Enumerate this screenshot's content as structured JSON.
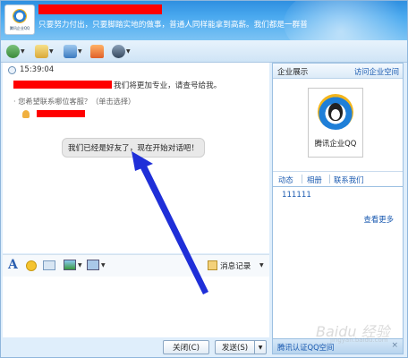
{
  "header": {
    "avatar_caption": "腾讯企业QQ",
    "signature": "只要努力付出，只要脚踏实地的做事，普通人同样能拿到高薪。我们都是一群普通人，我们同样..."
  },
  "toolbar": {
    "buttons": [
      {
        "icon": "add-contact-icon"
      },
      {
        "icon": "file-transfer-icon"
      },
      {
        "icon": "video-icon"
      },
      {
        "icon": "home-icon"
      },
      {
        "icon": "agent-icon"
      }
    ]
  },
  "chat": {
    "timestamp": "15:39:04",
    "greeting": "我们将更加专业，请查号给我。",
    "prompt": "· 您希望联系哪位客服？（单击选择）",
    "bubble": "我们已经是好友了，现在开始对话吧！"
  },
  "input_toolbar": {
    "history_label": "消息记录"
  },
  "buttons": {
    "close": "关闭(C)",
    "send": "发送(S)"
  },
  "panel": {
    "title": "企业展示",
    "visit_link": "访问企业空间",
    "logo_text": "腾讯企业QQ",
    "tabs": [
      "动态",
      "相册",
      "联系我们"
    ],
    "item": "111111",
    "more": "查看更多",
    "footer": "腾讯认证QQ空间"
  },
  "watermark": {
    "main": "Baidu 经验",
    "sub": "jingyan.baidu.com"
  },
  "colors": {
    "accent": "#2f8fe0",
    "link": "#1a5ab0",
    "redaction": "#ff0000",
    "arrow": "#1f2fd8"
  }
}
